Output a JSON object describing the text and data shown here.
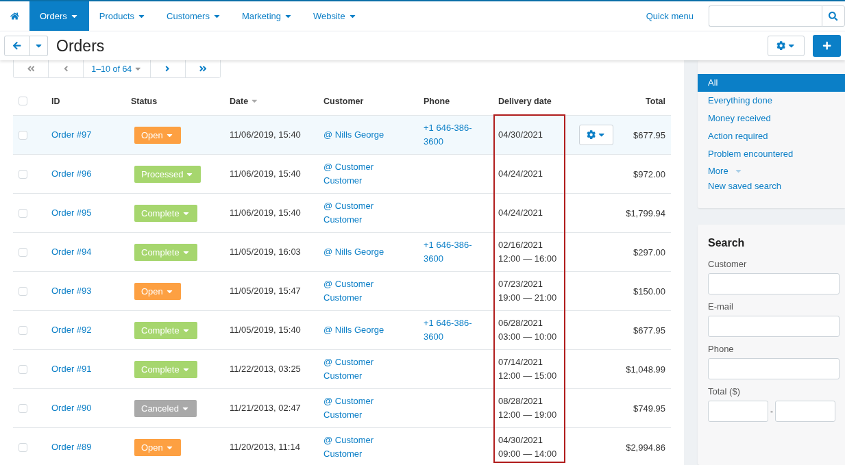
{
  "nav": {
    "items": [
      {
        "kind": "home",
        "selected": false
      },
      {
        "kind": "menu",
        "label": "Orders",
        "selected": true
      },
      {
        "kind": "menu",
        "label": "Products",
        "selected": false
      },
      {
        "kind": "menu",
        "label": "Customers",
        "selected": false
      },
      {
        "kind": "menu",
        "label": "Marketing",
        "selected": false
      },
      {
        "kind": "menu",
        "label": "Website",
        "selected": false
      }
    ],
    "quick_menu": "Quick menu"
  },
  "header": {
    "title": "Orders"
  },
  "pagination": {
    "range": "1–10 of 64"
  },
  "table": {
    "select_all": {
      "checked": false
    },
    "delivery_frame": true,
    "columns": [
      {
        "label": "ID",
        "sorted": false
      },
      {
        "label": "Status",
        "sorted": false
      },
      {
        "label": "Date",
        "sorted": true
      },
      {
        "label": "Customer",
        "sorted": false
      },
      {
        "label": "Phone",
        "sorted": false
      },
      {
        "label": "Delivery date",
        "sorted": false
      },
      {
        "label": "Total",
        "sorted": false
      }
    ],
    "rows": [
      {
        "checked": false,
        "id": "Order #97",
        "status": "Open",
        "color": "#fda042",
        "date": "11/06/2019, 15:40",
        "customer": "@ Nills George",
        "phone": "+1 646-386-3600",
        "delivery": [
          "04/30/2021"
        ],
        "total": "$677.95",
        "hovered": true
      },
      {
        "checked": false,
        "id": "Order #96",
        "status": "Processed",
        "color": "#a6d66e",
        "date": "11/06/2019, 15:40",
        "customer": "@ Customer Customer",
        "delivery": [
          "04/24/2021"
        ],
        "total": "$972.00",
        "hovered": false
      },
      {
        "checked": false,
        "id": "Order #95",
        "status": "Complete",
        "color": "#a6d66e",
        "date": "11/06/2019, 15:40",
        "customer": "@ Customer Customer",
        "delivery": [
          "04/24/2021"
        ],
        "total": "$1,799.94",
        "hovered": false
      },
      {
        "checked": false,
        "id": "Order #94",
        "status": "Complete",
        "color": "#a6d66e",
        "date": "11/05/2019, 16:03",
        "customer": "@ Nills George",
        "phone": "+1 646-386-3600",
        "delivery": [
          "02/16/2021",
          "12:00 — 16:00"
        ],
        "total": "$297.00",
        "hovered": false
      },
      {
        "checked": false,
        "id": "Order #93",
        "status": "Open",
        "color": "#fda042",
        "date": "11/05/2019, 15:47",
        "customer": "@ Customer Customer",
        "delivery": [
          "07/23/2021",
          "19:00 — 21:00"
        ],
        "total": "$150.00",
        "hovered": false
      },
      {
        "checked": false,
        "id": "Order #92",
        "status": "Complete",
        "color": "#a6d66e",
        "date": "11/05/2019, 15:40",
        "customer": "@ Nills George",
        "phone": "+1 646-386-3600",
        "delivery": [
          "06/28/2021",
          "03:00 — 10:00"
        ],
        "total": "$677.95",
        "hovered": false
      },
      {
        "checked": false,
        "id": "Order #91",
        "status": "Complete",
        "color": "#a6d66e",
        "date": "11/22/2013, 03:25",
        "customer": "@ Customer Customer",
        "delivery": [
          "07/14/2021",
          "12:00 — 15:00"
        ],
        "total": "$1,048.99",
        "hovered": false
      },
      {
        "checked": false,
        "id": "Order #90",
        "status": "Canceled",
        "color": "#a9a9a9",
        "date": "11/21/2013, 02:47",
        "customer": "@ Customer Customer",
        "delivery": [
          "08/28/2021",
          "12:00 — 19:00"
        ],
        "total": "$749.95",
        "hovered": false
      },
      {
        "checked": false,
        "id": "Order #89",
        "status": "Open",
        "color": "#fda042",
        "date": "11/20/2013, 11:14",
        "customer": "@ Customer Customer",
        "delivery": [
          "04/30/2021",
          "09:00 — 14:00"
        ],
        "total": "$2,994.86",
        "hovered": false
      }
    ]
  },
  "saved_searches": {
    "items": [
      {
        "label": "All",
        "selected": true
      },
      {
        "label": "Everything done",
        "selected": false
      },
      {
        "label": "Money received",
        "selected": false
      },
      {
        "label": "Action required",
        "selected": false
      },
      {
        "label": "Problem encountered",
        "selected": false
      }
    ],
    "more": "More",
    "new": "New saved search"
  },
  "search": {
    "title": "Search",
    "fields": [
      {
        "kind": "single",
        "label": "Customer"
      },
      {
        "kind": "single",
        "label": "E-mail"
      },
      {
        "kind": "single",
        "label": "Phone"
      },
      {
        "kind": "range",
        "label": "Total ($)",
        "separator": "-"
      }
    ]
  }
}
